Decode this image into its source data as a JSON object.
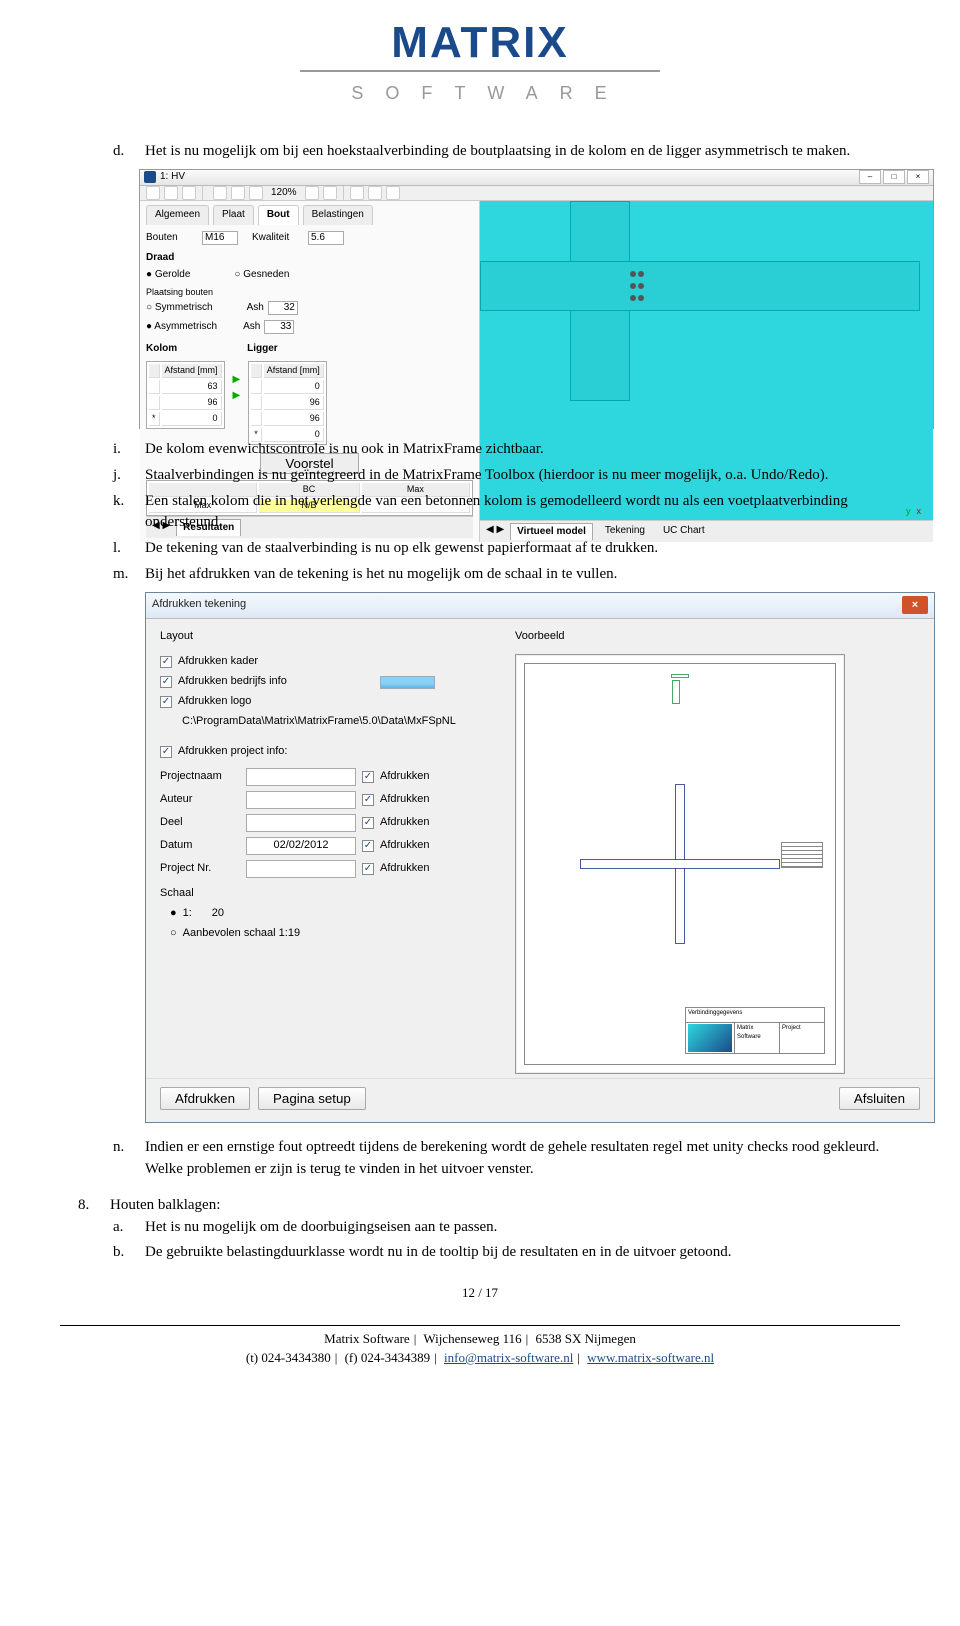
{
  "logo": {
    "main": "MATRIX",
    "sub": "SOFTWARE"
  },
  "list1": {
    "d": "Het is nu mogelijk om bij een hoekstaalverbinding de boutplaatsing in de kolom en de ligger asymmetrisch te maken.",
    "i": "De kolom evenwichtscontrole is nu ook in MatrixFrame zichtbaar.",
    "j": "Staalverbindingen is nu geïntegreerd in de MatrixFrame Toolbox (hierdoor is nu meer mogelijk, o.a. Undo/Redo).",
    "k": "Een stalen kolom die in het verlengde van een betonnen kolom is gemodelleerd wordt nu als een voetplaatverbinding ondersteund.",
    "l": "De tekening van de staalverbinding is nu op elk gewenst papierformaat af te drukken.",
    "m": "Bij het afdrukken van de tekening is het nu mogelijk om de schaal in te vullen.",
    "n": "Indien er een ernstige fout optreedt tijdens de berekening wordt de gehele resultaten regel met unity checks rood gekleurd. Welke problemen er zijn is terug te vinden in het uitvoer venster."
  },
  "section8": {
    "title": "Houten balklagen:",
    "a": "Het is nu mogelijk om de doorbuigingseisen aan te passen.",
    "b": "De gebruikte belastingduurklasse wordt nu in de tooltip bij de resultaten en in de uitvoer getoond."
  },
  "app": {
    "title": "1: HV",
    "toolbar_zoom": "120%",
    "tabs": [
      "Algemeen",
      "Plaat",
      "Bout",
      "Belastingen"
    ],
    "bouten_label": "Bouten",
    "bouten_size": "M16",
    "kwaliteit_label": "Kwaliteit",
    "kwaliteit_val": "5.6",
    "draad_label": "Draad",
    "draad_opts": [
      "Gerolde",
      "Gesneden"
    ],
    "plaatsing_label": "Plaatsing bouten",
    "plaatsing_opts": [
      "Symmetrisch",
      "Asymmetrisch"
    ],
    "ash_label": "Ash",
    "ash1": "32",
    "ash2": "33",
    "kolom_label": "Kolom",
    "ligger_label": "Ligger",
    "afstand_hdr": "Afstand [mm]",
    "kolom_vals": [
      "63",
      "96",
      "0"
    ],
    "ligger_vals": [
      "0",
      "96",
      "96",
      "0"
    ],
    "voorstel_btn": "Voorstel",
    "mini_hdr": [
      "",
      "BC",
      "Max"
    ],
    "mini_row": [
      "Max",
      "N/B",
      ""
    ],
    "left_bottom_tab": "Resultaten",
    "right_bottom_tabs": [
      "Virtueel model",
      "Tekening",
      "UC Chart"
    ]
  },
  "dialog": {
    "title": "Afdrukken tekening",
    "layout_h": "Layout",
    "voorbeeld_h": "Voorbeeld",
    "chk_kader": "Afdrukken kader",
    "chk_bedrijfs": "Afdrukken bedrijfs info",
    "chk_logo": "Afdrukken logo",
    "logo_path": "C:\\ProgramData\\Matrix\\MatrixFrame\\5.0\\Data\\MxFSpNL",
    "chk_project": "Afdrukken project info:",
    "fields": {
      "projectnaam": "Projectnaam",
      "auteur": "Auteur",
      "deel": "Deel",
      "datum": "Datum",
      "datum_val": "02/02/2012",
      "projectnr": "Project Nr."
    },
    "afdrukken_chk": "Afdrukken",
    "schaal_label": "Schaal",
    "schaal_1": "1:",
    "schaal_val": "20",
    "schaal_aanbevolen": "Aanbevolen schaal 1:19",
    "btn_afdrukken": "Afdrukken",
    "btn_pagina": "Pagina setup",
    "btn_afsluiten": "Afsluiten",
    "stamp": {
      "title": "Verbindinggegevens",
      "company": "Matrix Software",
      "project": "Project"
    }
  },
  "page_num": "12 / 17",
  "footer": {
    "line1a": "Matrix Software",
    "line1b": "Wijchenseweg 116",
    "line1c": "6538 SX Nijmegen",
    "line2a": "(t) 024-3434380",
    "line2b": "(f) 024-3434389",
    "email": "info@matrix-software.nl",
    "url": "www.matrix-software.nl"
  }
}
